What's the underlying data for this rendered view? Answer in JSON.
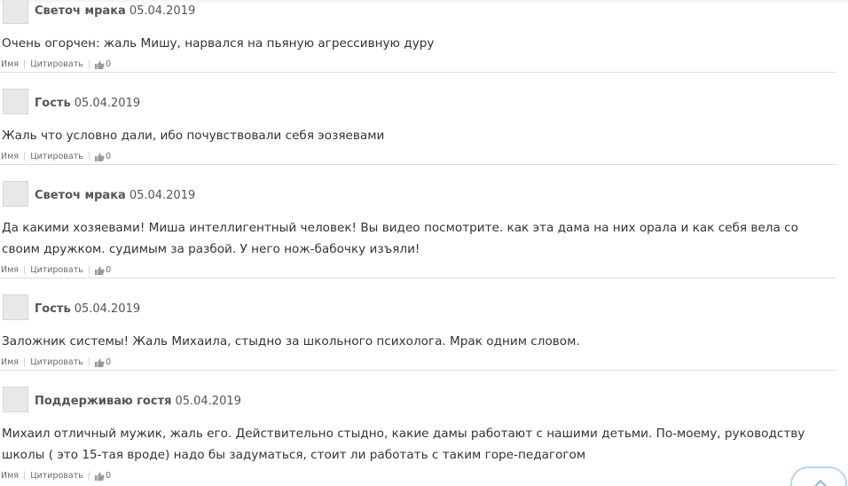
{
  "labels": {
    "name": "Имя",
    "quote": "Цитировать",
    "separator": "|"
  },
  "comments": [
    {
      "author": "Светоч мрака",
      "date": "05.04.2019",
      "text": "Очень огорчен: жаль Мишу, нарвался на пьяную агрессивную дуру",
      "likes": "0"
    },
    {
      "author": "Гость",
      "date": "05.04.2019",
      "text": "Жаль что условно дали, ибо почувствовали себя эозяевами",
      "likes": "0"
    },
    {
      "author": "Светоч мрака",
      "date": "05.04.2019",
      "text": "Да какими хозяевами! Миша интеллигентный человек! Вы видео посмотрите. как эта дама на них орала и как себя вела со своим дружком. судимым за разбой. У него нож-бабочку изъяли!",
      "likes": "0"
    },
    {
      "author": "Гость",
      "date": "05.04.2019",
      "text": "Заложник системы! Жаль Михаила, стыдно за школьного психолога. Мрак одним словом.",
      "likes": "0"
    },
    {
      "author": "Поддерживаю гостя",
      "date": "05.04.2019",
      "text": "Михаил отличный мужик, жаль его. Действительно стыдно, какие дамы работают с нашими детьми. По-моему, руководству школы ( это 15-тая вроде) надо бы задуматься, стоит ли работать с таким горе-педагогом",
      "likes": "0"
    }
  ]
}
